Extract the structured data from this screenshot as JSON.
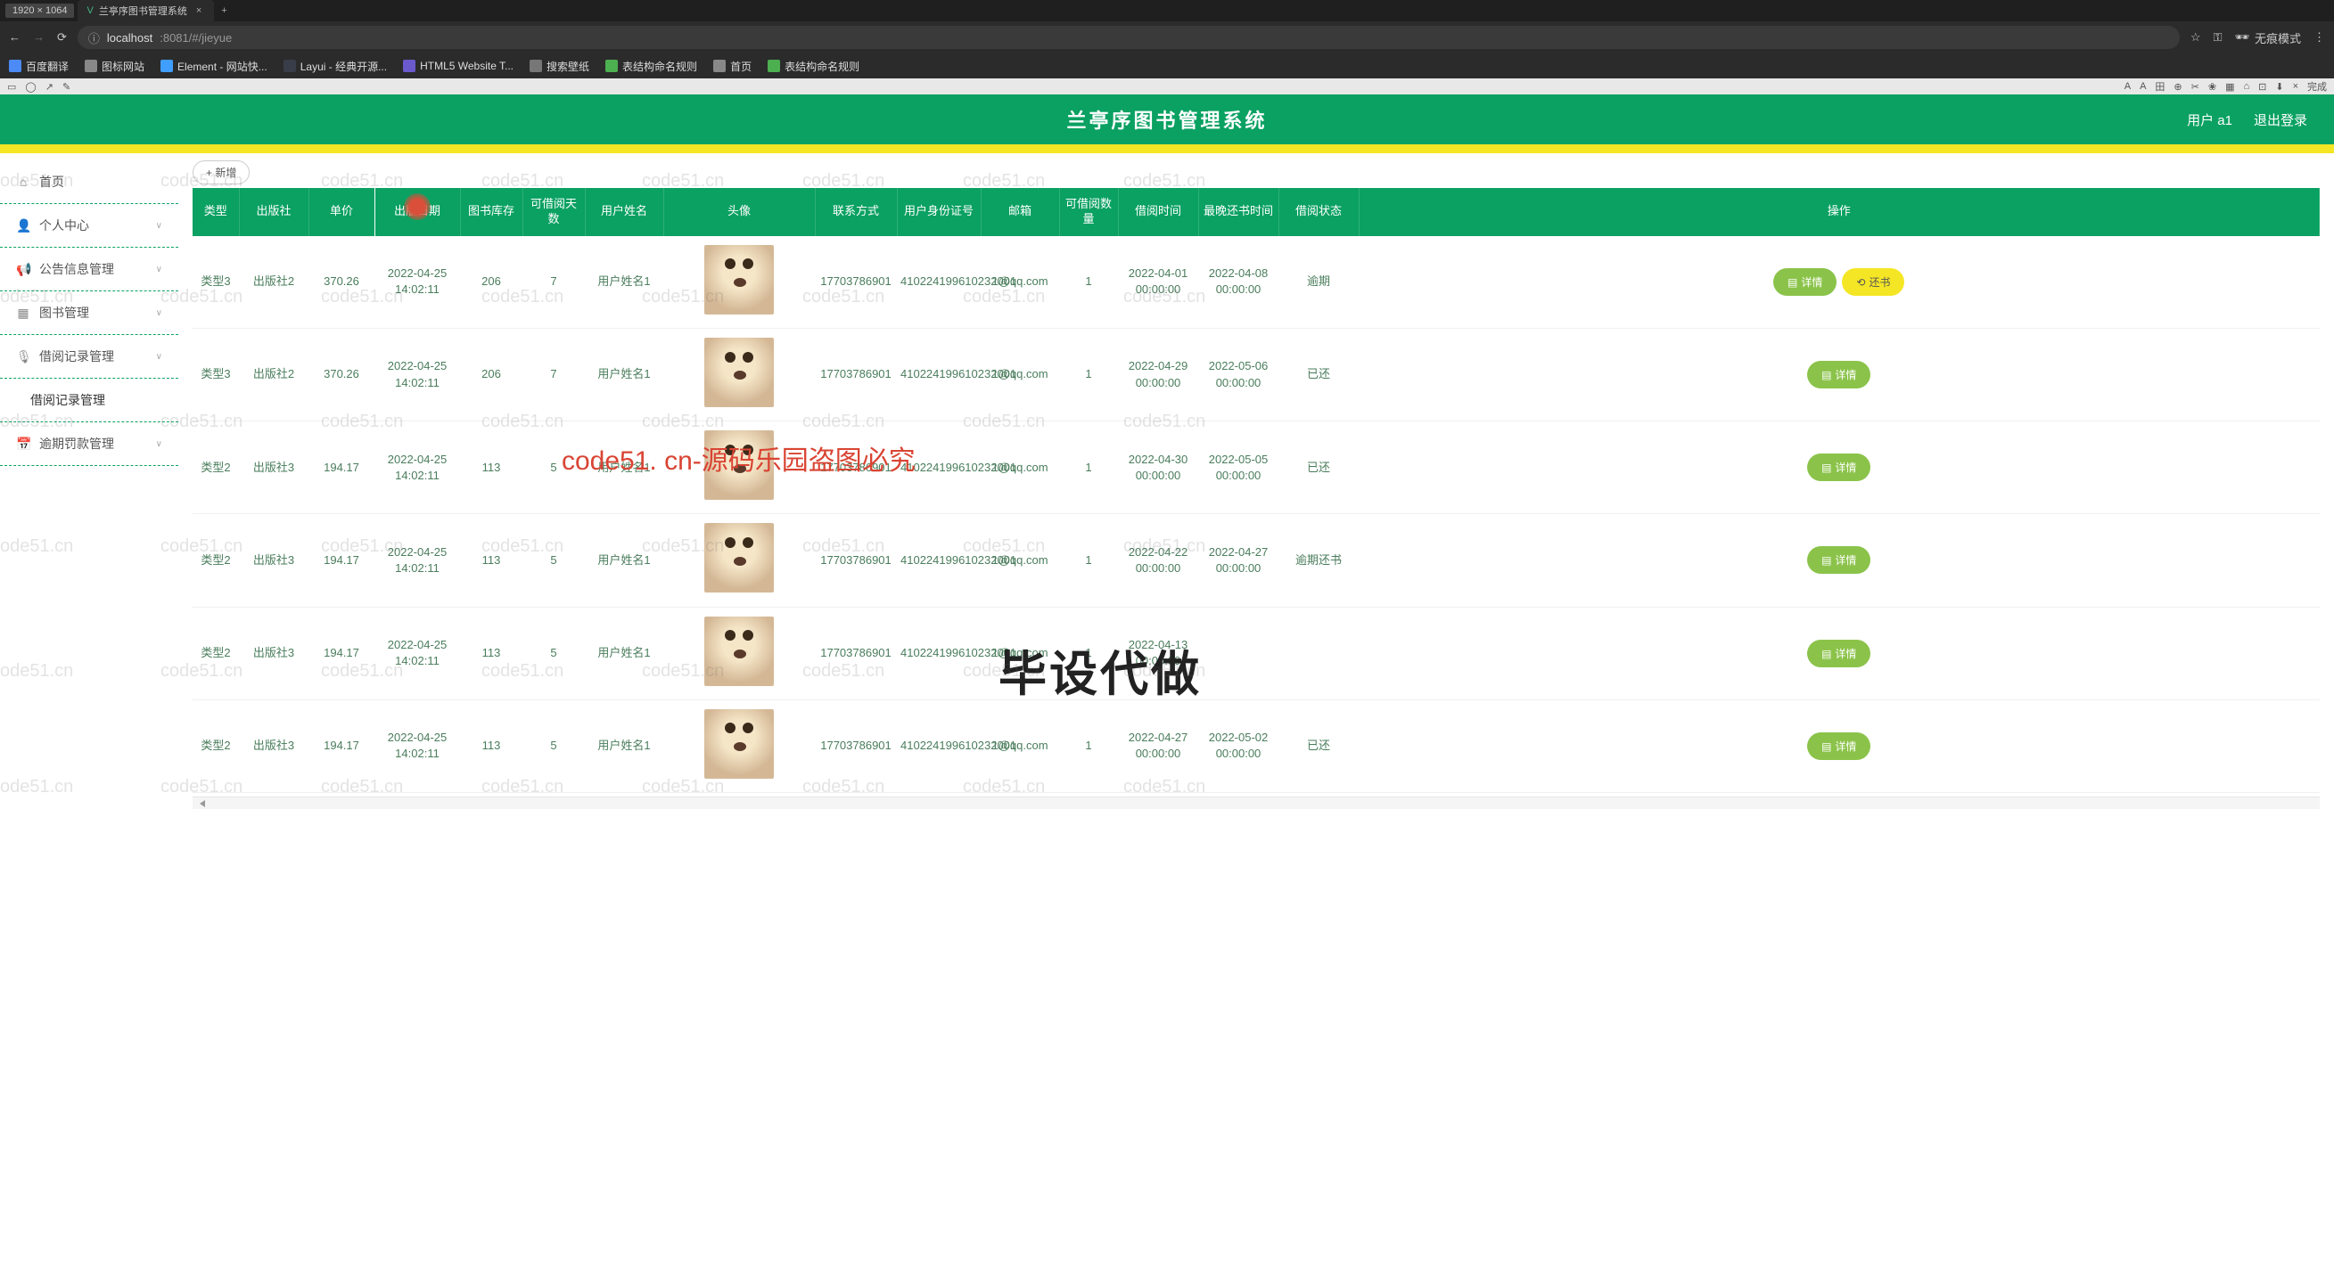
{
  "browser": {
    "dim_badge": "1920 × 1064",
    "tab_title": "兰亭序图书管理系统",
    "url_info": "ⓘ",
    "url_host": "localhost",
    "url_port": ":8081/#/jieyue",
    "incognito": "无痕模式",
    "bookmarks": [
      "百度翻译",
      "图标网站",
      "Element - 网站快...",
      "Layui - 经典开源...",
      "HTML5 Website T...",
      "搜索壁纸",
      "表结构命名规则",
      "首页",
      "表结构命名规则"
    ]
  },
  "header": {
    "title": "兰亭序图书管理系统",
    "user": "用户 a1",
    "logout": "退出登录"
  },
  "sidebar": {
    "items": [
      {
        "icon": "⌂",
        "label": "首页"
      },
      {
        "icon": "👤",
        "label": "个人中心",
        "arrow": "∨"
      },
      {
        "icon": "📢",
        "label": "公告信息管理",
        "arrow": "∨"
      },
      {
        "icon": "▦",
        "label": "图书管理",
        "arrow": "∨"
      },
      {
        "icon": "🎙",
        "label": "借阅记录管理",
        "arrow": "∨"
      },
      {
        "icon": "",
        "label": "借阅记录管理",
        "sub": true
      },
      {
        "icon": "📅",
        "label": "逾期罚款管理",
        "arrow": "∨"
      }
    ]
  },
  "toolbar": {
    "add": "+ 新增"
  },
  "table": {
    "headers": [
      "类型",
      "出版社",
      "单价",
      "出版日期",
      "图书库存",
      "可借阅天数",
      "用户姓名",
      "头像",
      "联系方式",
      "用户身份证号",
      "邮箱",
      "可借阅数量",
      "借阅时间",
      "最晚还书时间",
      "借阅状态",
      "操作"
    ],
    "rows": [
      {
        "type": "类型3",
        "pub": "出版社2",
        "price": "370.26",
        "date": "2022-04-25 14:02:11",
        "stock": "206",
        "days": "7",
        "user": "用户姓名1",
        "contact": "17703786901",
        "idcard": "410224199610232001",
        "email": "1@qq.com",
        "qty": "1",
        "btime": "2022-04-01 00:00:00",
        "rtime": "2022-04-08 00:00:00",
        "status": "逾期",
        "ops": [
          "详情",
          "还书"
        ]
      },
      {
        "type": "类型3",
        "pub": "出版社2",
        "price": "370.26",
        "date": "2022-04-25 14:02:11",
        "stock": "206",
        "days": "7",
        "user": "用户姓名1",
        "contact": "17703786901",
        "idcard": "410224199610232001",
        "email": "1@qq.com",
        "qty": "1",
        "btime": "2022-04-29 00:00:00",
        "rtime": "2022-05-06 00:00:00",
        "status": "已还",
        "ops": [
          "详情"
        ]
      },
      {
        "type": "类型2",
        "pub": "出版社3",
        "price": "194.17",
        "date": "2022-04-25 14:02:11",
        "stock": "113",
        "days": "5",
        "user": "用户姓名1",
        "contact": "17703786901",
        "idcard": "410224199610232001",
        "email": "1@qq.com",
        "qty": "1",
        "btime": "2022-04-30 00:00:00",
        "rtime": "2022-05-05 00:00:00",
        "status": "已还",
        "ops": [
          "详情"
        ]
      },
      {
        "type": "类型2",
        "pub": "出版社3",
        "price": "194.17",
        "date": "2022-04-25 14:02:11",
        "stock": "113",
        "days": "5",
        "user": "用户姓名1",
        "contact": "17703786901",
        "idcard": "410224199610232001",
        "email": "1@qq.com",
        "qty": "1",
        "btime": "2022-04-22 00:00:00",
        "rtime": "2022-04-27 00:00:00",
        "status": "逾期还书",
        "ops": [
          "详情"
        ]
      },
      {
        "type": "类型2",
        "pub": "出版社3",
        "price": "194.17",
        "date": "2022-04-25 14:02:11",
        "stock": "113",
        "days": "5",
        "user": "用户姓名1",
        "contact": "17703786901",
        "idcard": "410224199610232001",
        "email": "1@qq.com",
        "qty": "1",
        "btime": "2022-04-13 00:00:00",
        "rtime": "",
        "status": "",
        "ops": [
          "详情"
        ]
      },
      {
        "type": "类型2",
        "pub": "出版社3",
        "price": "194.17",
        "date": "2022-04-25 14:02:11",
        "stock": "113",
        "days": "5",
        "user": "用户姓名1",
        "contact": "17703786901",
        "idcard": "410224199610232001",
        "email": "1@qq.com",
        "qty": "1",
        "btime": "2022-04-27 00:00:00",
        "rtime": "2022-05-02 00:00:00",
        "status": "已还",
        "ops": [
          "详情"
        ]
      }
    ],
    "btn_detail": "详情",
    "btn_return": "还书"
  },
  "watermarks": {
    "grey": "code51.cn",
    "red": "code51. cn-源码乐园盗图必究",
    "big": "毕设代做"
  }
}
